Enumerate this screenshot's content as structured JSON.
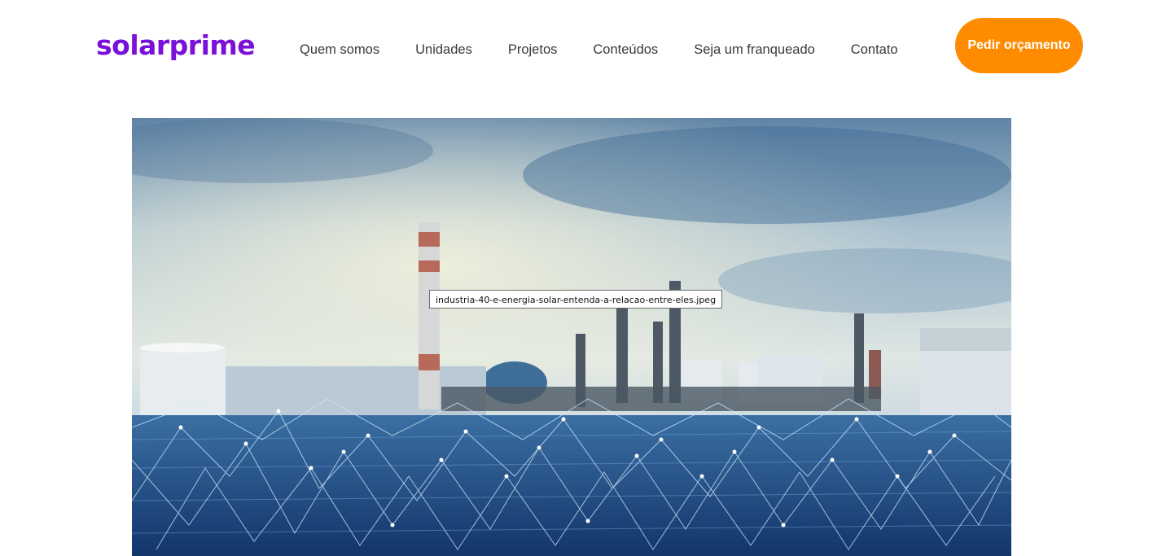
{
  "brand": {
    "logo_text": "solarprime",
    "primary_color": "#7a10d9",
    "accent_color": "#ff8c00"
  },
  "nav": {
    "items": [
      {
        "label": "Quem somos"
      },
      {
        "label": "Unidades"
      },
      {
        "label": "Projetos"
      },
      {
        "label": "Conteúdos"
      },
      {
        "label": "Seja um franqueado"
      },
      {
        "label": "Contato"
      }
    ]
  },
  "cta": {
    "label": "Pedir orçamento"
  },
  "hero": {
    "tooltip": "industria-40-e-energia-solar-entenda-a-relacao-entre-eles.jpeg"
  }
}
